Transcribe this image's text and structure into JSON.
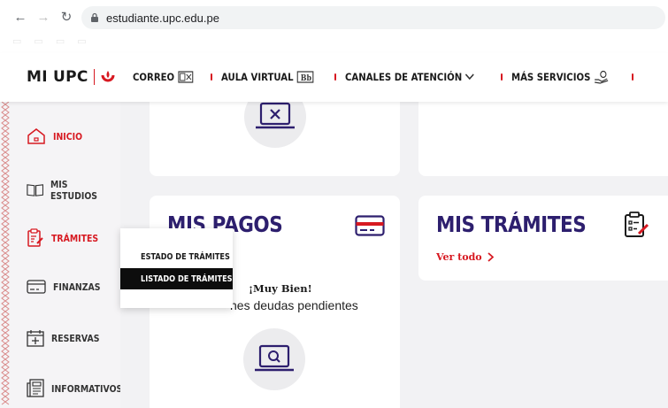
{
  "browser": {
    "url": "estudiante.upc.edu.pe"
  },
  "header": {
    "brand": "MI UPC",
    "nav": [
      {
        "label": "CORREO",
        "icon": "mail-icon"
      },
      {
        "label": "AULA VIRTUAL",
        "icon": "blackboard-icon"
      },
      {
        "label": "CANALES DE ATENCIÓN",
        "icon": "chevron-down-icon"
      },
      {
        "label": "MÁS SERVICIOS",
        "icon": "hand-service-icon"
      }
    ]
  },
  "sidebar": {
    "items": [
      {
        "label": "INICIO",
        "icon": "home-icon",
        "active": true
      },
      {
        "label": "MIS ESTUDIOS",
        "icon": "book-icon"
      },
      {
        "label": "TRÁMITES",
        "icon": "document-edit-icon",
        "active": true
      },
      {
        "label": "FINANZAS",
        "icon": "card-icon"
      },
      {
        "label": "RESERVAS",
        "icon": "calendar-plus-icon"
      },
      {
        "label": "INFORMATIVOS",
        "icon": "newspaper-icon"
      }
    ]
  },
  "dropdown": {
    "items": [
      {
        "label": "ESTADO DE TRÁMITES"
      },
      {
        "label": "LISTADO DE TRÁMITES",
        "selected": true
      }
    ]
  },
  "cards": {
    "pagos": {
      "title": "MIS PAGOS",
      "message_bold": "¡Muy Bien!",
      "message": "nes deudas pendientes"
    },
    "tramites": {
      "title": "MIS TRÁMITES",
      "link": "Ver todo"
    }
  },
  "colors": {
    "accent": "#d71921",
    "title": "#2d1f6e"
  }
}
